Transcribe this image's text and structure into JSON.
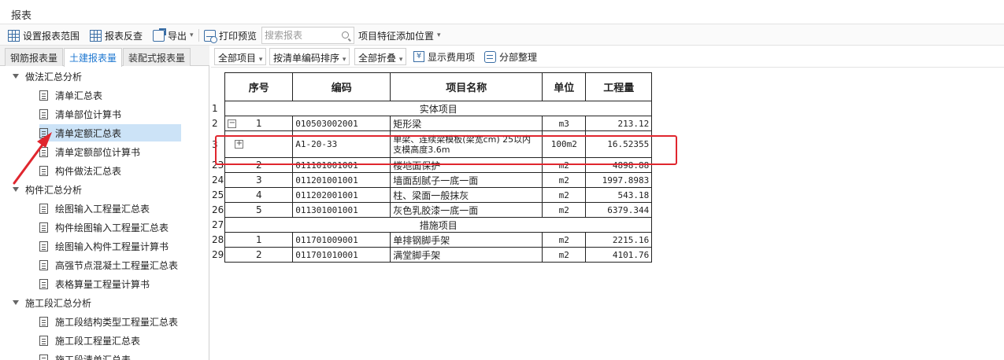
{
  "window": {
    "title": "报表"
  },
  "toolbar": {
    "set_range": "设置报表范围",
    "reverse_check": "报表反查",
    "export": "导出",
    "print_preview": "打印预览",
    "search_placeholder": "搜索报表",
    "feature_position": "项目特征添加位置"
  },
  "tabs": [
    "钢筋报表量",
    "土建报表量",
    "装配式报表量"
  ],
  "active_tab": 1,
  "tree": [
    {
      "label": "做法汇总分析",
      "type": "group"
    },
    {
      "label": "清单汇总表",
      "type": "leaf"
    },
    {
      "label": "清单部位计算书",
      "type": "leaf"
    },
    {
      "label": "清单定额汇总表",
      "type": "leaf",
      "selected": true
    },
    {
      "label": "清单定额部位计算书",
      "type": "leaf"
    },
    {
      "label": "构件做法汇总表",
      "type": "leaf"
    },
    {
      "label": "构件汇总分析",
      "type": "group"
    },
    {
      "label": "绘图输入工程量汇总表",
      "type": "leaf"
    },
    {
      "label": "构件绘图输入工程量汇总表",
      "type": "leaf"
    },
    {
      "label": "绘图输入构件工程量计算书",
      "type": "leaf"
    },
    {
      "label": "高强节点混凝土工程量汇总表",
      "type": "leaf"
    },
    {
      "label": "表格算量工程量计算书",
      "type": "leaf"
    },
    {
      "label": "施工段汇总分析",
      "type": "group"
    },
    {
      "label": "施工段结构类型工程量汇总表",
      "type": "leaf"
    },
    {
      "label": "施工段工程量汇总表",
      "type": "leaf"
    },
    {
      "label": "施工段清单汇总表",
      "type": "leaf"
    }
  ],
  "report_toolbar": {
    "all_items": "全部项目",
    "sort_by_code": "按清单编码排序",
    "collapse_all": "全部折叠",
    "show_cost_items": "显示费用项",
    "section_organize": "分部整理"
  },
  "table": {
    "headers": [
      "序号",
      "编码",
      "项目名称",
      "单位",
      "工程量"
    ],
    "rows": [
      {
        "rn": "1",
        "section": "实体项目"
      },
      {
        "rn": "2",
        "toggle": "−",
        "seq": "1",
        "code": "010503002001",
        "name": "矩形梁",
        "unit": "m3",
        "qty": "213.12"
      },
      {
        "rn": "3",
        "toggle": "+",
        "seq": "",
        "code": "A1-20-33",
        "name": "单梁、连续梁模板(梁宽cm) 25以内 支模高度3.6m",
        "unit": "100m2",
        "qty": "16.52355"
      },
      {
        "rn": "23",
        "seq": "2",
        "code": "011101001001",
        "name": "楼地面保护",
        "unit": "m2",
        "qty": "4898.88"
      },
      {
        "rn": "24",
        "seq": "3",
        "code": "011201001001",
        "name": "墙面刮腻子一底一面",
        "unit": "m2",
        "qty": "1997.8983"
      },
      {
        "rn": "25",
        "seq": "4",
        "code": "011202001001",
        "name": "柱、梁面一般抹灰",
        "unit": "m2",
        "qty": "543.18"
      },
      {
        "rn": "26",
        "seq": "5",
        "code": "011301001001",
        "name": "灰色乳胶漆一底一面",
        "unit": "m2",
        "qty": "6379.344"
      },
      {
        "rn": "27",
        "section": "措施项目"
      },
      {
        "rn": "28",
        "seq": "1",
        "code": "011701009001",
        "name": "单排钢脚手架",
        "unit": "m2",
        "qty": "2215.16"
      },
      {
        "rn": "29",
        "seq": "2",
        "code": "011701010001",
        "name": "满堂脚手架",
        "unit": "m2",
        "qty": "4101.76"
      }
    ]
  },
  "colors": {
    "accent": "#1f78d1",
    "highlight": "#e0262e",
    "selected_bg": "#cce3f7"
  }
}
